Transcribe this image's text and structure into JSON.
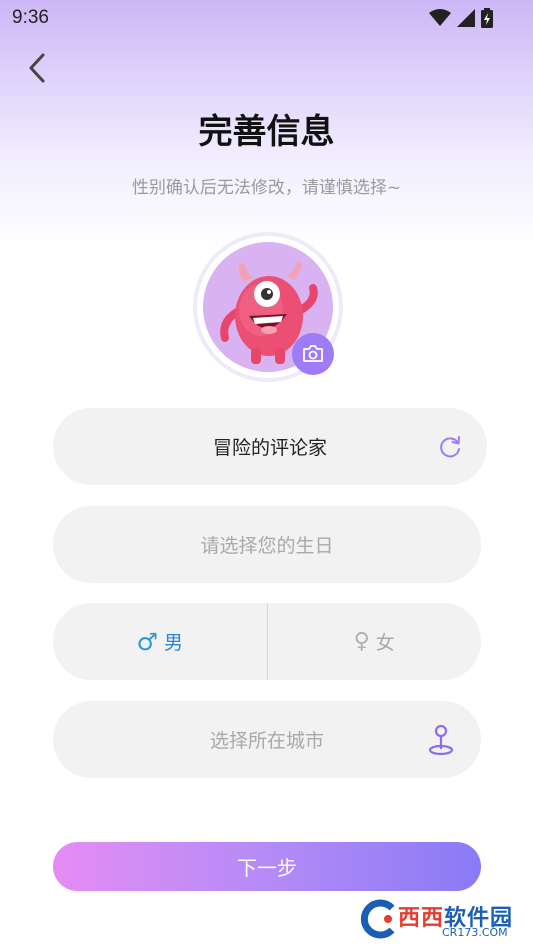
{
  "status_bar": {
    "time": "9:36",
    "icons": [
      "wifi-icon",
      "cellular-signal-icon",
      "battery-charging-icon"
    ]
  },
  "header": {
    "back_icon": "chevron-left-icon",
    "title": "完善信息",
    "subtitle": "性别确认后无法修改，请谨慎选择~"
  },
  "avatar": {
    "image": "pink-one-eyed-monster-avatar",
    "camera_icon": "camera-icon"
  },
  "form": {
    "nickname": {
      "value": "冒险的评论家",
      "action_icon": "refresh-icon"
    },
    "birthday": {
      "placeholder": "请选择您的生日"
    },
    "gender": {
      "male": {
        "symbol": "♂",
        "label": "男",
        "selected": true
      },
      "female": {
        "symbol": "♀",
        "label": "女",
        "selected": false
      }
    },
    "city": {
      "placeholder": "选择所在城市",
      "action_icon": "location-pin-icon"
    }
  },
  "next_button": {
    "label": "下一步"
  },
  "watermark": {
    "brand_a": "西西",
    "brand_b": "软件园",
    "domain": "CR173.COM"
  },
  "colors": {
    "accent": "#9d7cf6",
    "male": "#2a86d8",
    "button_gradient_start": "#e58cf4",
    "button_gradient_end": "#8a7af6",
    "field_bg": "#f2f2f2"
  }
}
